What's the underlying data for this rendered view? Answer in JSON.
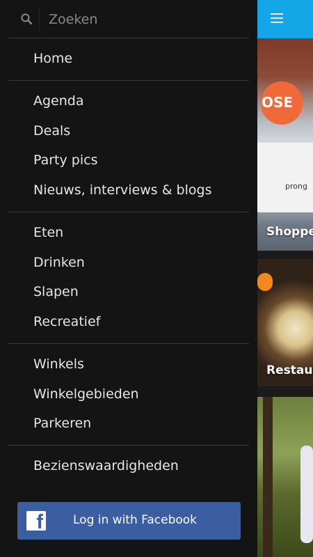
{
  "search": {
    "placeholder": "Zoeken"
  },
  "menu": {
    "home": "Home",
    "agenda": "Agenda",
    "deals": "Deals",
    "party_pics": "Party pics",
    "nieuws": "Nieuws, interviews & blogs",
    "eten": "Eten",
    "drinken": "Drinken",
    "slapen": "Slapen",
    "recreatief": "Recreatief",
    "winkels": "Winkels",
    "winkelgebieden": "Winkelgebieden",
    "parkeren": "Parkeren",
    "bezienswaardigheden": "Bezienswaardigheden"
  },
  "facebook": {
    "label": "Log in with Facebook"
  },
  "background": {
    "card1_caption": "Shoppen",
    "card1_sign": "OSE",
    "card1_panel_text": "prong",
    "card2_caption": "Restaurants"
  },
  "colors": {
    "accent": "#13a7e8",
    "facebook": "#3b5da2",
    "drawer_bg": "#141414"
  }
}
